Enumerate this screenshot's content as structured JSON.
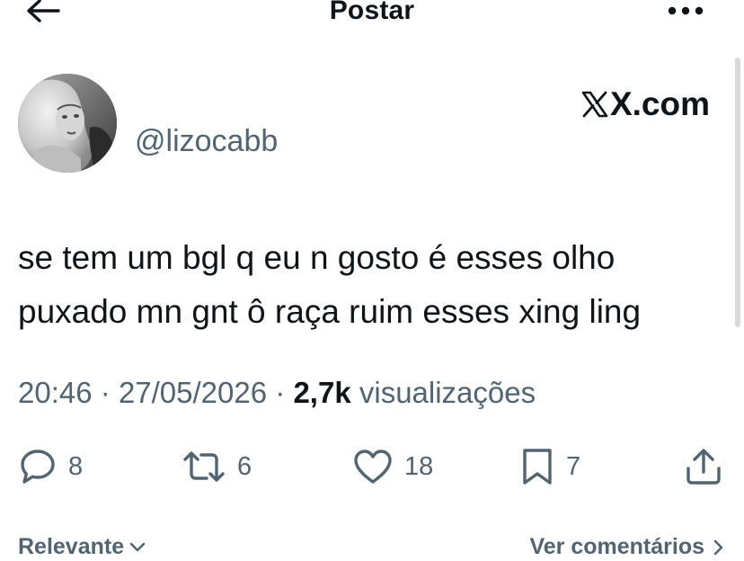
{
  "header": {
    "title": "Postar",
    "back_icon": "arrow-left-icon",
    "more_icon": "more-horizontal-icon"
  },
  "tweet": {
    "handle": "@lizocabb",
    "brand": "X.com",
    "text_lines": [
      "se tem um bgl q eu n gosto é esses olho",
      "puxado mn gnt ô raça ruim esses xing ling"
    ],
    "time": "20:46",
    "date": "27/05/2026",
    "views_count": "2,7k",
    "views_label": "visualizações"
  },
  "actions": {
    "reply_count": "8",
    "retweet_count": "6",
    "like_count": "18",
    "bookmark_count": "7"
  },
  "footer": {
    "sort_label": "Relevante",
    "comments_link": "Ver comentários"
  },
  "colors": {
    "text_primary": "#0f1419",
    "text_secondary": "#536471",
    "background": "#ffffff"
  }
}
